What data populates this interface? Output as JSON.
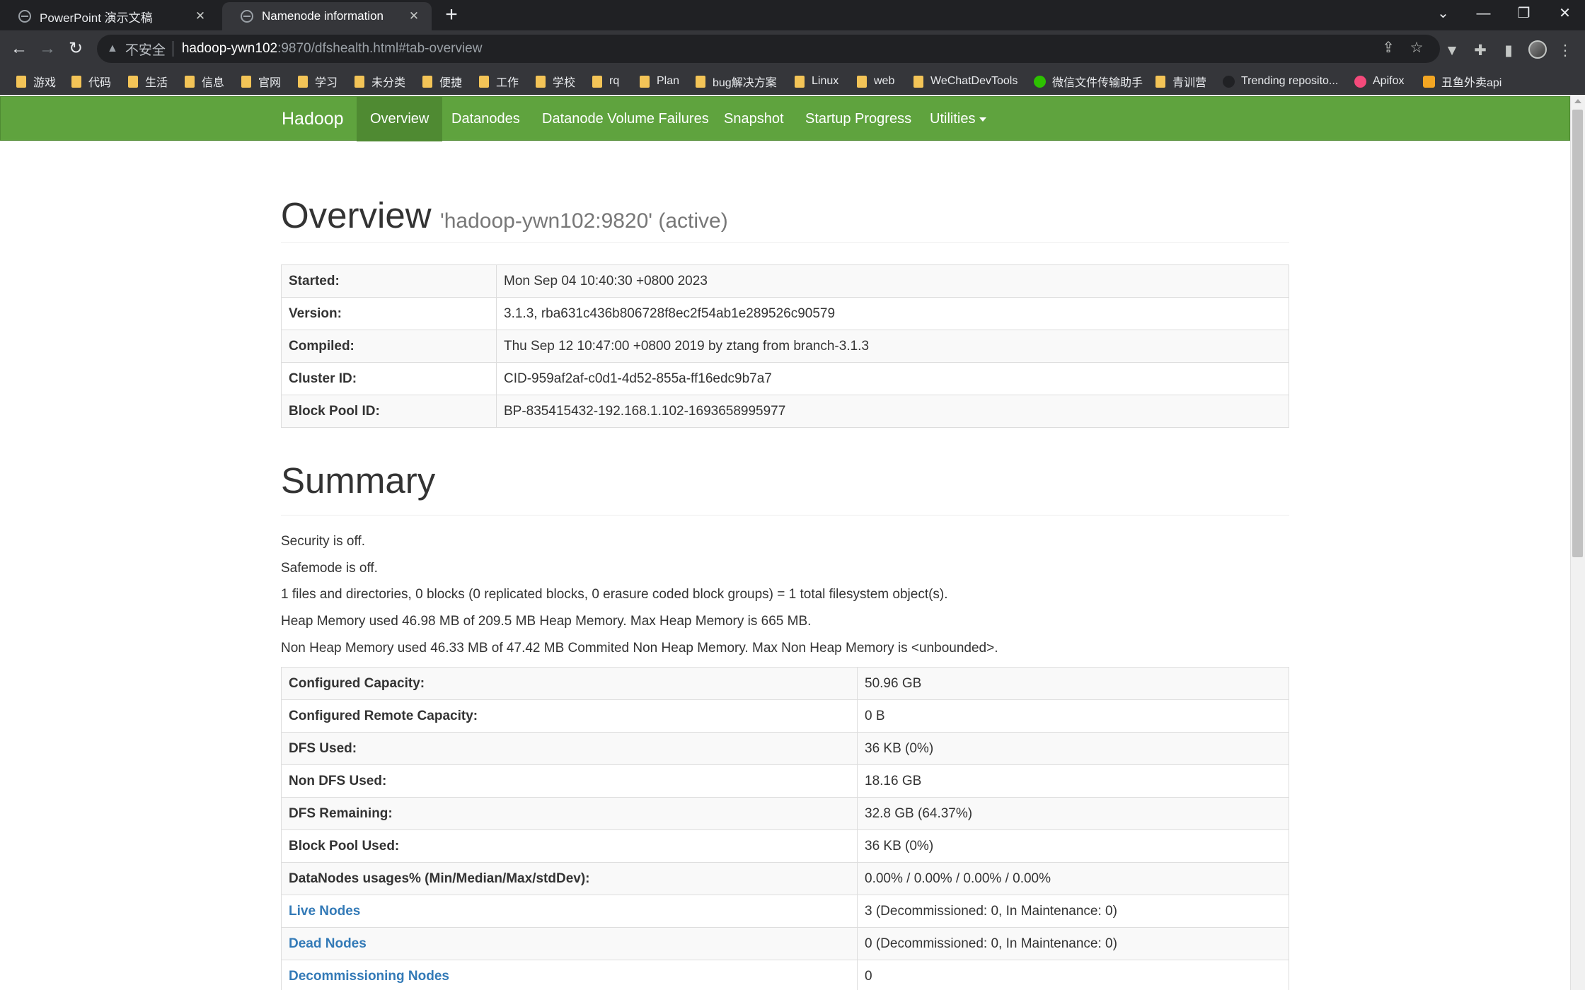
{
  "browser": {
    "tabs": [
      {
        "title": "PowerPoint 演示文稿",
        "close": "✕"
      },
      {
        "title": "Namenode information",
        "close": "✕"
      }
    ],
    "new_tab": "+",
    "window_controls": {
      "tabsearch": "⌄",
      "minimize": "—",
      "restore": "❐",
      "close": "✕"
    },
    "nav": {
      "back": "←",
      "forward": "→",
      "reload": "↻"
    },
    "address": {
      "security_label": "不安全",
      "warning_icon": "▲",
      "host": "hadoop-ywn102",
      "path": ":9870/dfshealth.html#tab-overview"
    },
    "omnibox_icons": {
      "share": "⇪",
      "star": "☆"
    },
    "toolbar_icons": {
      "vpn": "▼",
      "extensions": "✚",
      "sidepanel": "▮",
      "menu": "⋮"
    },
    "bookmarks": [
      {
        "label": "游戏",
        "type": "folder"
      },
      {
        "label": "代码",
        "type": "folder"
      },
      {
        "label": "生活",
        "type": "folder"
      },
      {
        "label": "信息",
        "type": "folder"
      },
      {
        "label": "官网",
        "type": "folder"
      },
      {
        "label": "学习",
        "type": "folder"
      },
      {
        "label": "未分类",
        "type": "folder"
      },
      {
        "label": "便捷",
        "type": "folder"
      },
      {
        "label": "工作",
        "type": "folder"
      },
      {
        "label": "学校",
        "type": "folder"
      },
      {
        "label": "rq",
        "type": "folder"
      },
      {
        "label": "Plan",
        "type": "folder"
      },
      {
        "label": "bug解决方案",
        "type": "folder"
      },
      {
        "label": "Linux",
        "type": "folder"
      },
      {
        "label": "web",
        "type": "folder"
      },
      {
        "label": "WeChatDevTools",
        "type": "folder"
      },
      {
        "label": "微信文件传输助手",
        "type": "wechat",
        "color": "#2dc100"
      },
      {
        "label": "青训营",
        "type": "folder"
      },
      {
        "label": "Trending reposito...",
        "type": "github",
        "color": "#202124"
      },
      {
        "label": "Apifox",
        "type": "apifox",
        "color": "#f44a7b"
      },
      {
        "label": "丑鱼外卖api",
        "type": "yapi",
        "color": "#f3a623"
      }
    ]
  },
  "hadoop": {
    "brand": "Hadoop",
    "nav": [
      "Overview",
      "Datanodes",
      "Datanode Volume Failures",
      "Snapshot",
      "Startup Progress",
      "Utilities"
    ],
    "colors": {
      "navbar": "#5fa33e",
      "active": "#4f8a32",
      "link": "#337ab7"
    },
    "overview": {
      "title": "Overview",
      "subtitle": "'hadoop-ywn102:9820' (active)",
      "rows": [
        {
          "k": "Started:",
          "v": "Mon Sep 04 10:40:30 +0800 2023"
        },
        {
          "k": "Version:",
          "v": "3.1.3, rba631c436b806728f8ec2f54ab1e289526c90579"
        },
        {
          "k": "Compiled:",
          "v": "Thu Sep 12 10:47:00 +0800 2019 by ztang from branch-3.1.3"
        },
        {
          "k": "Cluster ID:",
          "v": "CID-959af2af-c0d1-4d52-855a-ff16edc9b7a7"
        },
        {
          "k": "Block Pool ID:",
          "v": "BP-835415432-192.168.1.102-1693658995977"
        }
      ]
    },
    "summary": {
      "title": "Summary",
      "lines": [
        "Security is off.",
        "Safemode is off.",
        "1 files and directories, 0 blocks (0 replicated blocks, 0 erasure coded block groups) = 1 total filesystem object(s).",
        "Heap Memory used 46.98 MB of 209.5 MB Heap Memory. Max Heap Memory is 665 MB.",
        "Non Heap Memory used 46.33 MB of 47.42 MB Commited Non Heap Memory. Max Non Heap Memory is <unbounded>."
      ],
      "rows": [
        {
          "k": "Configured Capacity:",
          "v": "50.96 GB"
        },
        {
          "k": "Configured Remote Capacity:",
          "v": "0 B"
        },
        {
          "k": "DFS Used:",
          "v": "36 KB (0%)"
        },
        {
          "k": "Non DFS Used:",
          "v": "18.16 GB"
        },
        {
          "k": "DFS Remaining:",
          "v": "32.8 GB (64.37%)"
        },
        {
          "k": "Block Pool Used:",
          "v": "36 KB (0%)"
        },
        {
          "k": "DataNodes usages% (Min/Median/Max/stdDev):",
          "v": "0.00% / 0.00% / 0.00% / 0.00%"
        },
        {
          "k": "Live Nodes",
          "v": "3 (Decommissioned: 0, In Maintenance: 0)",
          "link": true
        },
        {
          "k": "Dead Nodes",
          "v": "0 (Decommissioned: 0, In Maintenance: 0)",
          "link": true
        },
        {
          "k": "Decommissioning Nodes",
          "v": "0",
          "link": true
        }
      ]
    }
  }
}
